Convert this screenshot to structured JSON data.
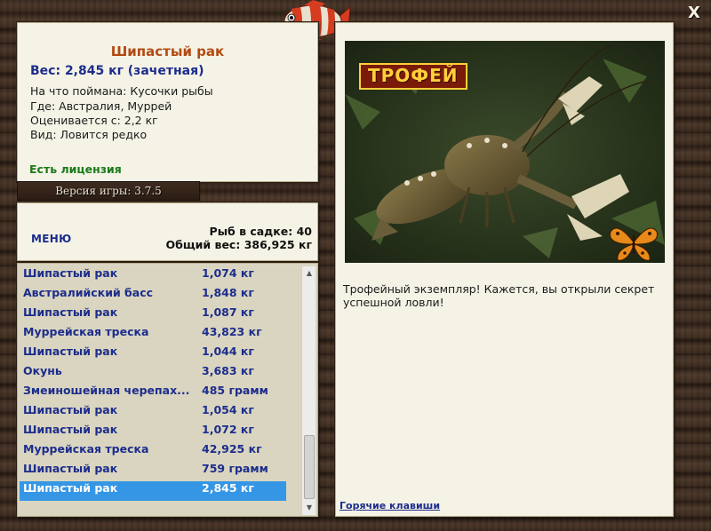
{
  "close_label": "X",
  "catch": {
    "name": "Шипастый рак",
    "weight_line": "Вес: 2,845 кг (зачетная)",
    "bait": "На что поймана: Кусочки рыбы",
    "location": "Где: Австралия, Муррей",
    "min_weight": "Оценивается с: 2,2 кг",
    "rarity": "Вид: Ловится редко",
    "license": "Есть лицензия"
  },
  "version": "Версия игры: 3.7.5",
  "menu_label": "МЕНЮ",
  "stats": {
    "fish_count": "Рыб в садке: 40",
    "total_weight": "Общий вес: 386,925 кг"
  },
  "fish_list": [
    {
      "name": "Шипастый рак",
      "weight": "1,074 кг"
    },
    {
      "name": "Австралийский басс",
      "weight": "1,848 кг"
    },
    {
      "name": "Шипастый рак",
      "weight": "1,087 кг"
    },
    {
      "name": "Муррейская треска",
      "weight": "43,823 кг"
    },
    {
      "name": "Шипастый рак",
      "weight": "1,044 кг"
    },
    {
      "name": "Окунь",
      "weight": "3,683 кг"
    },
    {
      "name": "Змеиношейная черепах...",
      "weight": "485 грамм"
    },
    {
      "name": "Шипастый рак",
      "weight": "1,054 кг"
    },
    {
      "name": "Шипастый рак",
      "weight": "1,072 кг"
    },
    {
      "name": "Муррейская треска",
      "weight": "42,925 кг"
    },
    {
      "name": "Шипастый рак",
      "weight": "759 грамм"
    },
    {
      "name": "Шипастый рак",
      "weight": "2,845 кг"
    }
  ],
  "selected_index": 11,
  "trophy": {
    "badge": "ТРОФЕЙ",
    "message": "Трофейный экземпляр! Кажется, вы открыли секрет успешной ловли!"
  },
  "hotkeys_label": "Горячие клавиши",
  "icons": {
    "close": "close-icon",
    "fish_deco": "fish-icon",
    "butterfly": "butterfly-icon",
    "scroll_up": "chevron-up-icon",
    "scroll_down": "chevron-down-icon"
  },
  "colors": {
    "title": "#b34a12",
    "link": "#1c2d8c",
    "license": "#1a7a1a",
    "selection": "#3596e6"
  }
}
